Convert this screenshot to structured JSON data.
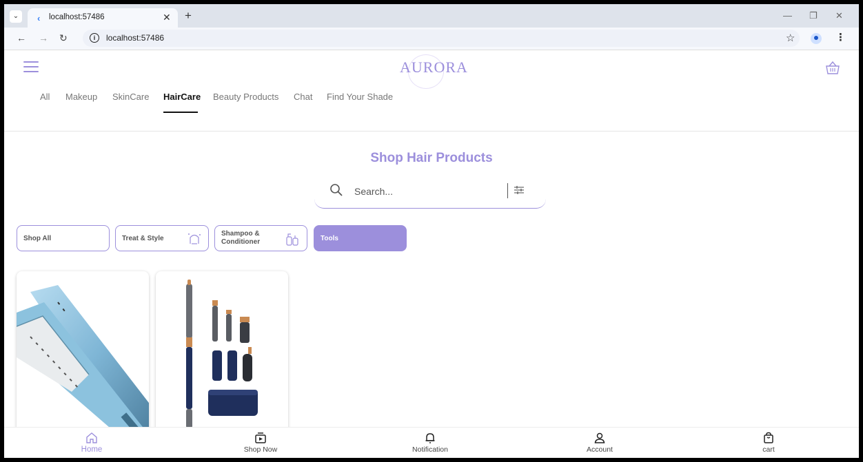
{
  "browser": {
    "tab_title": "localhost:57486",
    "url": "localhost:57486"
  },
  "app": {
    "logo": "AURORA",
    "categories": [
      {
        "label": "All"
      },
      {
        "label": "Makeup"
      },
      {
        "label": "SkinCare"
      },
      {
        "label": "HairCare"
      },
      {
        "label": "Beauty Products"
      },
      {
        "label": "Chat"
      },
      {
        "label": "Find Your Shade"
      }
    ],
    "active_category": "HairCare",
    "accent_color": "#9c8fdc"
  },
  "main": {
    "title": "Shop Hair Products",
    "search_placeholder": "Search...",
    "chips": [
      {
        "label": "Shop All",
        "icon": "none"
      },
      {
        "label": "Treat & Style",
        "icon": "hair-treatment-icon"
      },
      {
        "label": "Shampoo & Conditioner",
        "line1": "Shampoo &",
        "line2": "Conditioner",
        "icon": "shampoo-bottles-icon"
      },
      {
        "label": "Tools",
        "icon": "none"
      }
    ],
    "selected_chip": "Tools",
    "products": [
      {
        "image": "hair-straightener-image"
      },
      {
        "image": "hair-styler-set-image"
      }
    ]
  },
  "bottom_nav": [
    {
      "label": "Home",
      "icon": "home-icon"
    },
    {
      "label": "Shop Now",
      "icon": "shop-play-icon"
    },
    {
      "label": "Notification",
      "icon": "bell-icon"
    },
    {
      "label": "Account",
      "icon": "person-icon"
    },
    {
      "label": "cart",
      "icon": "shopping-bag-icon"
    }
  ],
  "bottom_nav_active": "Home"
}
